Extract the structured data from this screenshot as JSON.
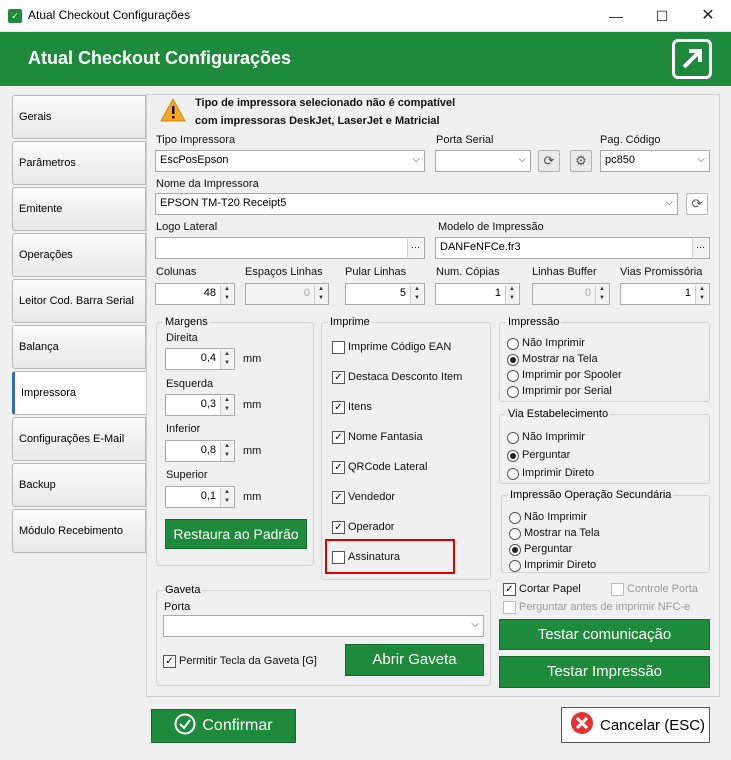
{
  "window": {
    "title": "Atual Checkout Configurações"
  },
  "header": {
    "title": "Atual Checkout Configurações"
  },
  "sidebar": {
    "items": [
      {
        "label": "Gerais"
      },
      {
        "label": "Parâmetros"
      },
      {
        "label": "Emitente"
      },
      {
        "label": "Operações"
      },
      {
        "label": "Leitor Cod. Barra Serial"
      },
      {
        "label": "Balança"
      },
      {
        "label": "Impressora"
      },
      {
        "label": "Configurações E-Mail"
      },
      {
        "label": "Backup"
      },
      {
        "label": "Módulo Recebimento"
      }
    ]
  },
  "warning": {
    "line1": "Tipo de impressora selecionado não é compatível",
    "line2": "com impressoras DeskJet, LaserJet e Matricial"
  },
  "printer": {
    "tipo_label": "Tipo Impressora",
    "tipo_value": "EscPosEpson",
    "porta_label": "Porta Serial",
    "porta_value": "",
    "pag_label": "Pag. Código",
    "pag_value": "pc850",
    "nome_label": "Nome da Impressora",
    "nome_value": "EPSON TM-T20 Receipt5",
    "logo_label": "Logo Lateral",
    "logo_value": "",
    "modelo_label": "Modelo de Impressão",
    "modelo_value": "DANFeNFCe.fr3",
    "colunas_label": "Colunas",
    "colunas_value": "48",
    "espacos_label": "Espaços Linhas",
    "espacos_value": "0",
    "pular_label": "Pular Linhas",
    "pular_value": "5",
    "copias_label": "Num. Cópias",
    "copias_value": "1",
    "buffer_label": "Linhas Buffer",
    "buffer_value": "0",
    "promissoria_label": "Vias Promissória",
    "promissoria_value": "1"
  },
  "margens": {
    "title": "Margens",
    "unit": "mm",
    "direita_label": "Direita",
    "direita_value": "0,4",
    "esquerda_label": "Esquerda",
    "esquerda_value": "0,3",
    "inferior_label": "Inferior",
    "inferior_value": "0,8",
    "superior_label": "Superior",
    "superior_value": "0,1",
    "restore_label": "Restaura ao Padrão"
  },
  "imprime": {
    "title": "Imprime",
    "items": [
      {
        "label": "Imprime Código EAN",
        "checked": false
      },
      {
        "label": "Destaca Desconto Item",
        "checked": true
      },
      {
        "label": "Itens",
        "checked": true
      },
      {
        "label": "Nome Fantasia",
        "checked": true
      },
      {
        "label": "QRCode Lateral",
        "checked": true
      },
      {
        "label": "Vendedor",
        "checked": true
      },
      {
        "label": "Operador",
        "checked": true
      },
      {
        "label": "Assinatura",
        "checked": false
      }
    ]
  },
  "impressao": {
    "title": "Impressão",
    "options": [
      "Não Imprimir",
      "Mostrar na Tela",
      "Imprimir por Spooler",
      "Imprimir por Serial"
    ],
    "selected": 1
  },
  "via": {
    "title": "Via Estabelecimento",
    "options": [
      "Não Imprimir",
      "Perguntar",
      "Imprimir Direto"
    ],
    "selected": 1
  },
  "secundaria": {
    "title": "Impressão Operação Secundária",
    "options": [
      "Não Imprimir",
      "Mostrar na Tela",
      "Perguntar",
      "Imprimir Direto"
    ],
    "selected": 2
  },
  "extras": {
    "cortar": "Cortar Papel",
    "controle": "Controle Porta",
    "perguntar_nfce": "Perguntar antes de imprimir NFC-e"
  },
  "gaveta": {
    "title": "Gaveta",
    "porta_label": "Porta",
    "porta_value": "",
    "permitir": "Permitir Tecla da Gaveta [G]",
    "abrir": "Abrir Gaveta"
  },
  "buttons": {
    "testar_com": "Testar comunicação",
    "testar_imp": "Testar Impressão",
    "confirmar": "Confirmar",
    "cancelar": "Cancelar (ESC)"
  },
  "colors": {
    "brand_green": "#1e8a3c",
    "highlight_red": "#e00000"
  }
}
